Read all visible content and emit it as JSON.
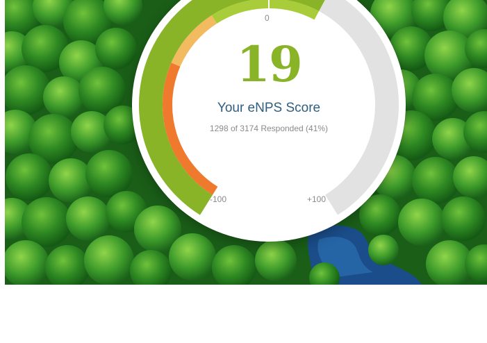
{
  "enps": {
    "score": "19",
    "score_value": 19,
    "label": "Your eNPS Score",
    "responded_text": "1298 of 3174 Responded (41%)",
    "tick_zero": "0",
    "tick_min": "-100",
    "tick_max": "+100"
  },
  "colors": {
    "score_green": "#8ab428",
    "label_blue": "#2f5e80",
    "gauge_track": "#e2e2e2",
    "gauge_green": "#8ab428",
    "gauge_light_green": "#a9cd3a",
    "gauge_yellow": "#f2bb5f",
    "gauge_orange": "#ef7a2e",
    "forest_dark": "#1f6a1c",
    "water": "#1b4d8a"
  }
}
